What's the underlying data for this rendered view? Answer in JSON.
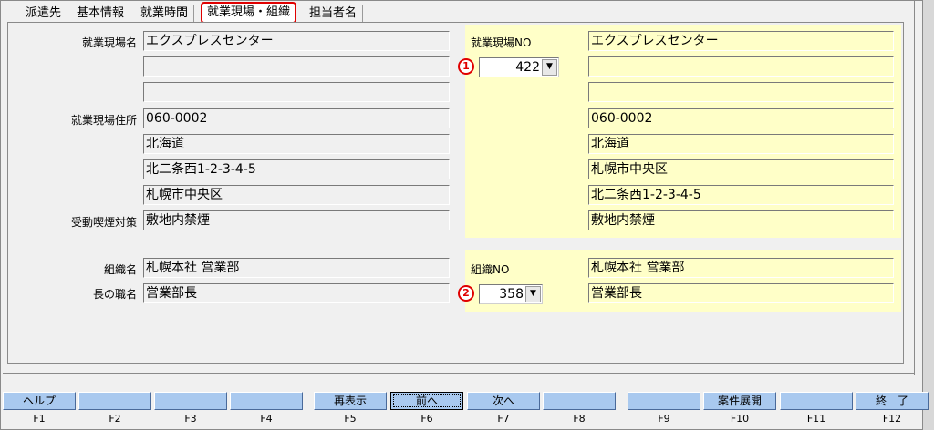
{
  "tabs": [
    {
      "label": "派遣先"
    },
    {
      "label": "基本情報"
    },
    {
      "label": "就業時間"
    },
    {
      "label": "就業現場・組織"
    },
    {
      "label": "担当者名"
    }
  ],
  "left": {
    "site_name_label": "就業現場名",
    "site_name": "エクスプレスセンター",
    "site_name2": "",
    "site_name3": "",
    "address_label": "就業現場住所",
    "postal": "060-0002",
    "pref": "北海道",
    "addr1": "北二条西1-2-3-4-5",
    "addr2": "札幌市中央区",
    "smoking_label": "受動喫煙対策",
    "smoking": "敷地内禁煙",
    "org_label": "組織名",
    "org": "札幌本社 営業部",
    "chief_label": "長の職名",
    "chief": "営業部長"
  },
  "right": {
    "site_no_label": "就業現場NO",
    "site_no": "422",
    "site_marker": "1",
    "site_name": "エクスプレスセンター",
    "site_name2": "",
    "site_name3": "",
    "postal": "060-0002",
    "pref": "北海道",
    "addr1": "札幌市中央区",
    "addr2": "北二条西1-2-3-4-5",
    "smoking": "敷地内禁煙",
    "org_no_label": "組織NO",
    "org_no": "358",
    "org_marker": "2",
    "org": "札幌本社 営業部",
    "chief": "営業部長"
  },
  "fkeys": [
    {
      "label": "ヘルプ",
      "num": "F1"
    },
    {
      "label": "",
      "num": "F2"
    },
    {
      "label": "",
      "num": "F3"
    },
    {
      "label": "",
      "num": "F4"
    },
    {
      "label": "再表示",
      "num": "F5"
    },
    {
      "label": "前へ",
      "num": "F6"
    },
    {
      "label": "次へ",
      "num": "F7"
    },
    {
      "label": "",
      "num": "F8"
    },
    {
      "label": "",
      "num": "F9"
    },
    {
      "label": "案件展開",
      "num": "F10"
    },
    {
      "label": "",
      "num": "F11"
    },
    {
      "label": "終　了",
      "num": "F12"
    }
  ]
}
